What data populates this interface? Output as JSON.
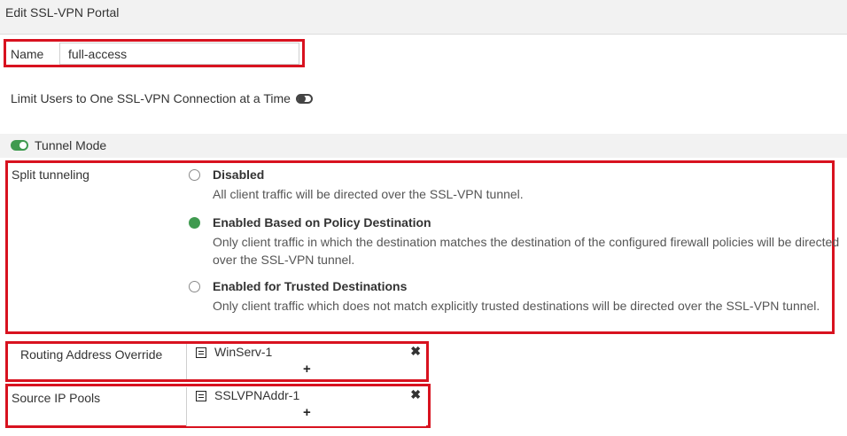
{
  "window": {
    "title": "Edit SSL-VPN Portal"
  },
  "name_field": {
    "label": "Name",
    "value": "full-access"
  },
  "limit_users": {
    "label": "Limit Users to One SSL-VPN Connection at a Time",
    "enabled": false
  },
  "tunnel_mode": {
    "label": "Tunnel Mode",
    "enabled": true
  },
  "split_tunneling": {
    "label": "Split tunneling",
    "options": [
      {
        "title": "Disabled",
        "description": "All client traffic will be directed over the SSL-VPN tunnel.",
        "selected": false
      },
      {
        "title": "Enabled Based on Policy Destination",
        "description": "Only client traffic in which the destination matches the destination of the configured firewall policies will be directed over the SSL-VPN tunnel.",
        "selected": true
      },
      {
        "title": "Enabled for Trusted Destinations",
        "description": "Only client traffic which does not match explicitly trusted destinations will be directed over the SSL-VPN tunnel.",
        "selected": false
      }
    ]
  },
  "routing_address_override": {
    "label": "Routing Address Override",
    "entries": [
      "WinServ-1"
    ],
    "add_symbol": "+",
    "remove_symbol": "✖"
  },
  "source_ip_pools": {
    "label": "Source IP Pools",
    "entries": [
      "SSLVPNAddr-1"
    ],
    "add_symbol": "+",
    "remove_symbol": "✖"
  },
  "colors": {
    "accent_green": "#3f9a4f",
    "highlight_red": "#d8121f"
  }
}
